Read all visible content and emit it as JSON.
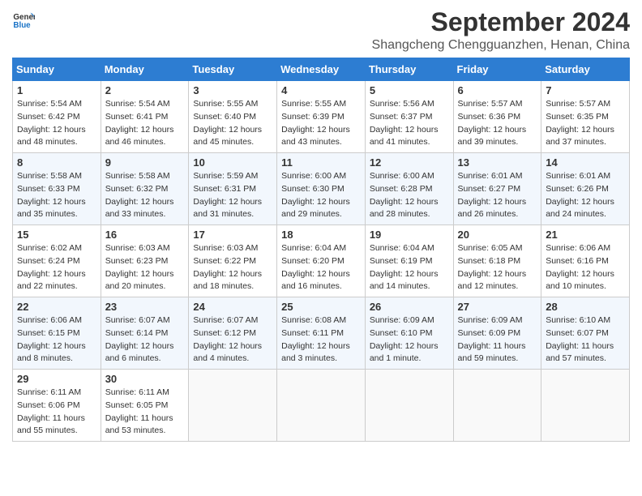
{
  "header": {
    "logo_line1": "General",
    "logo_line2": "Blue",
    "month": "September 2024",
    "location": "Shangcheng Chengguanzhen, Henan, China"
  },
  "days_of_week": [
    "Sunday",
    "Monday",
    "Tuesday",
    "Wednesday",
    "Thursday",
    "Friday",
    "Saturday"
  ],
  "weeks": [
    [
      {
        "day": "1",
        "sunrise": "5:54 AM",
        "sunset": "6:42 PM",
        "daylight": "12 hours and 48 minutes."
      },
      {
        "day": "2",
        "sunrise": "5:54 AM",
        "sunset": "6:41 PM",
        "daylight": "12 hours and 46 minutes."
      },
      {
        "day": "3",
        "sunrise": "5:55 AM",
        "sunset": "6:40 PM",
        "daylight": "12 hours and 45 minutes."
      },
      {
        "day": "4",
        "sunrise": "5:55 AM",
        "sunset": "6:39 PM",
        "daylight": "12 hours and 43 minutes."
      },
      {
        "day": "5",
        "sunrise": "5:56 AM",
        "sunset": "6:37 PM",
        "daylight": "12 hours and 41 minutes."
      },
      {
        "day": "6",
        "sunrise": "5:57 AM",
        "sunset": "6:36 PM",
        "daylight": "12 hours and 39 minutes."
      },
      {
        "day": "7",
        "sunrise": "5:57 AM",
        "sunset": "6:35 PM",
        "daylight": "12 hours and 37 minutes."
      }
    ],
    [
      {
        "day": "8",
        "sunrise": "5:58 AM",
        "sunset": "6:33 PM",
        "daylight": "12 hours and 35 minutes."
      },
      {
        "day": "9",
        "sunrise": "5:58 AM",
        "sunset": "6:32 PM",
        "daylight": "12 hours and 33 minutes."
      },
      {
        "day": "10",
        "sunrise": "5:59 AM",
        "sunset": "6:31 PM",
        "daylight": "12 hours and 31 minutes."
      },
      {
        "day": "11",
        "sunrise": "6:00 AM",
        "sunset": "6:30 PM",
        "daylight": "12 hours and 29 minutes."
      },
      {
        "day": "12",
        "sunrise": "6:00 AM",
        "sunset": "6:28 PM",
        "daylight": "12 hours and 28 minutes."
      },
      {
        "day": "13",
        "sunrise": "6:01 AM",
        "sunset": "6:27 PM",
        "daylight": "12 hours and 26 minutes."
      },
      {
        "day": "14",
        "sunrise": "6:01 AM",
        "sunset": "6:26 PM",
        "daylight": "12 hours and 24 minutes."
      }
    ],
    [
      {
        "day": "15",
        "sunrise": "6:02 AM",
        "sunset": "6:24 PM",
        "daylight": "12 hours and 22 minutes."
      },
      {
        "day": "16",
        "sunrise": "6:03 AM",
        "sunset": "6:23 PM",
        "daylight": "12 hours and 20 minutes."
      },
      {
        "day": "17",
        "sunrise": "6:03 AM",
        "sunset": "6:22 PM",
        "daylight": "12 hours and 18 minutes."
      },
      {
        "day": "18",
        "sunrise": "6:04 AM",
        "sunset": "6:20 PM",
        "daylight": "12 hours and 16 minutes."
      },
      {
        "day": "19",
        "sunrise": "6:04 AM",
        "sunset": "6:19 PM",
        "daylight": "12 hours and 14 minutes."
      },
      {
        "day": "20",
        "sunrise": "6:05 AM",
        "sunset": "6:18 PM",
        "daylight": "12 hours and 12 minutes."
      },
      {
        "day": "21",
        "sunrise": "6:06 AM",
        "sunset": "6:16 PM",
        "daylight": "12 hours and 10 minutes."
      }
    ],
    [
      {
        "day": "22",
        "sunrise": "6:06 AM",
        "sunset": "6:15 PM",
        "daylight": "12 hours and 8 minutes."
      },
      {
        "day": "23",
        "sunrise": "6:07 AM",
        "sunset": "6:14 PM",
        "daylight": "12 hours and 6 minutes."
      },
      {
        "day": "24",
        "sunrise": "6:07 AM",
        "sunset": "6:12 PM",
        "daylight": "12 hours and 4 minutes."
      },
      {
        "day": "25",
        "sunrise": "6:08 AM",
        "sunset": "6:11 PM",
        "daylight": "12 hours and 3 minutes."
      },
      {
        "day": "26",
        "sunrise": "6:09 AM",
        "sunset": "6:10 PM",
        "daylight": "12 hours and 1 minute."
      },
      {
        "day": "27",
        "sunrise": "6:09 AM",
        "sunset": "6:09 PM",
        "daylight": "11 hours and 59 minutes."
      },
      {
        "day": "28",
        "sunrise": "6:10 AM",
        "sunset": "6:07 PM",
        "daylight": "11 hours and 57 minutes."
      }
    ],
    [
      {
        "day": "29",
        "sunrise": "6:11 AM",
        "sunset": "6:06 PM",
        "daylight": "11 hours and 55 minutes."
      },
      {
        "day": "30",
        "sunrise": "6:11 AM",
        "sunset": "6:05 PM",
        "daylight": "11 hours and 53 minutes."
      },
      null,
      null,
      null,
      null,
      null
    ]
  ]
}
